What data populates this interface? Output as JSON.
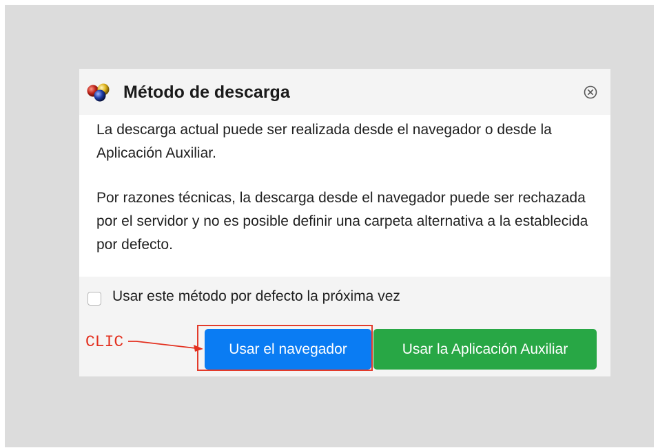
{
  "dialog": {
    "title": "Método de descarga",
    "paragraph1": "La descarga actual puede ser realizada desde el navegador o desde la Aplicación Auxiliar.",
    "paragraph2": "Por razones técnicas, la descarga desde el navegador puede ser rechazada por el servidor y no es posible definir una carpeta alternativa a la establecida por defecto.",
    "checkbox_label": "Usar este método por defecto la próxima vez",
    "checkbox_checked": false,
    "primary_button": "Usar el navegador",
    "secondary_button": "Usar la Aplicación Auxiliar",
    "icons": {
      "app": "three-spheres-icon",
      "close": "close-circle-icon"
    }
  },
  "annotation": {
    "label": "CLIC",
    "color": "#e3301f"
  },
  "colors": {
    "backdrop": "#dcdcdc",
    "header_bg": "#f4f4f4",
    "primary": "#0a7cf3",
    "success": "#28a745"
  }
}
